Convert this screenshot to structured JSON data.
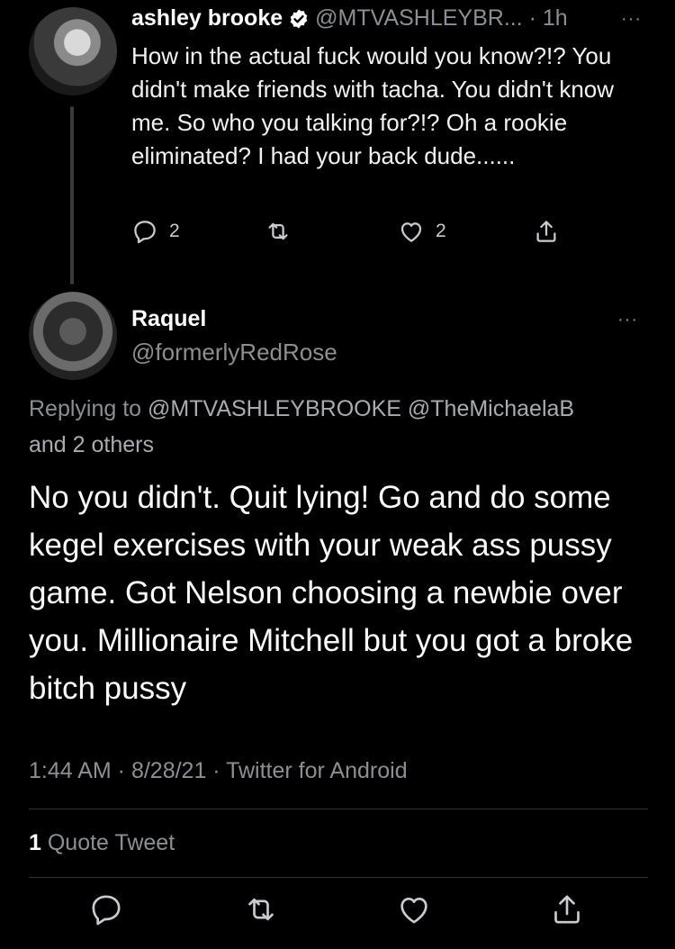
{
  "reply_target": {
    "author_name": "ashley brooke",
    "handle_time": "@MTVASHLEYBR... · 1h",
    "text": "How in the actual fuck would you know?!? You didn't make friends with tacha.  You didn't know me. So who you talking for?!? Oh a rookie eliminated? I had your back dude......",
    "reply_count": "2",
    "retweet_count": "",
    "like_count": "2",
    "more": "···"
  },
  "main_tweet": {
    "author_name": "Raquel",
    "handle": "@formerlyRedRose",
    "more": "···",
    "replying_prefix": "Replying to",
    "replying_to": "@MTVASHLEYBROOKE @TheMichaelaB",
    "replying_others": "and 2 others",
    "text": "No you didn't. Quit lying! Go and do some kegel exercises with your weak ass pussy game. Got Nelson choosing a newbie over you. Millionaire Mitchell but you got a broke bitch pussy",
    "meta": "1:44 AM · 8/28/21 · Twitter for Android",
    "quote_count": "1",
    "quote_label": "Quote Tweet"
  },
  "icons": [
    "verified-badge-icon",
    "reply-icon",
    "retweet-icon",
    "like-icon",
    "share-icon",
    "more-icon"
  ],
  "colors": {
    "background": "#000000",
    "text": "#ffffff",
    "muted": "#8b8f94",
    "divider": "#2f3336"
  }
}
